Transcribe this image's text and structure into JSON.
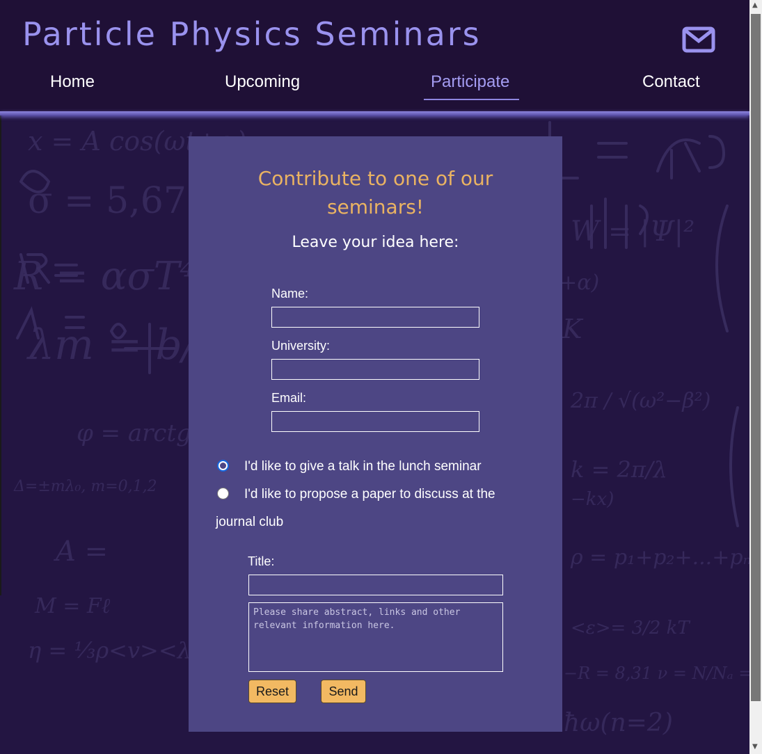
{
  "header": {
    "title": "Particle Physics Seminars",
    "mail_icon": "envelope-icon"
  },
  "nav": {
    "items": [
      {
        "label": "Home"
      },
      {
        "label": "Upcoming"
      },
      {
        "label": "Participate",
        "active": true
      },
      {
        "label": "Contact"
      }
    ]
  },
  "form": {
    "title_line1": "Contribute to one of our",
    "title_line2": "seminars!",
    "subtitle": "Leave your idea here:",
    "name_label": "Name:",
    "name_value": "",
    "university_label": "University:",
    "university_value": "",
    "email_label": "Email:",
    "email_value": "",
    "option_talk": "I'd like to give a talk in the lunch seminar",
    "option_paper_line1": "I'd like to propose a paper to discuss at the",
    "option_paper_line2": "journal club",
    "selected_option": "talk",
    "title_field_label": "Title:",
    "title_field_value": "",
    "details_placeholder": "Please share abstract, links and other relevant information here.",
    "reset_label": "Reset",
    "send_label": "Send"
  },
  "colors": {
    "header_bg": "#1f1036",
    "title": "#9a92ee",
    "panel_bg": "#4d4684",
    "accent_orange": "#eab362",
    "button_bg": "#f2b962"
  }
}
